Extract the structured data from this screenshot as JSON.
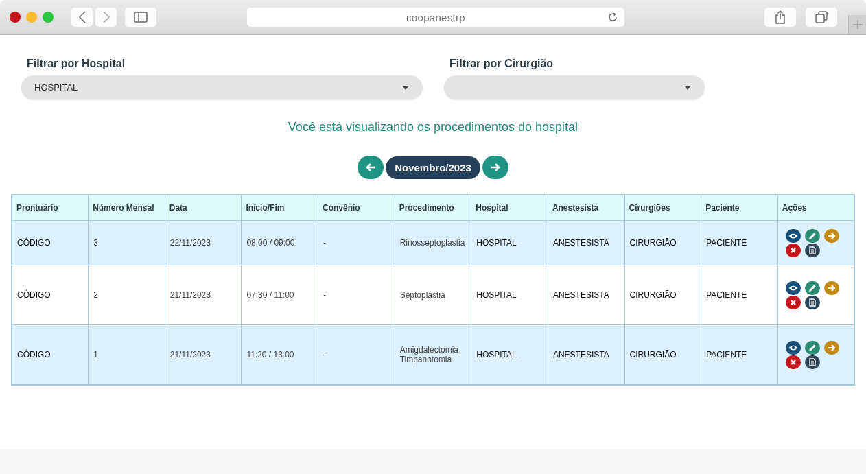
{
  "browser": {
    "url": "coopanestrp"
  },
  "filters": [
    {
      "label": "Filtrar por Hospital",
      "value": "HOSPITAL"
    },
    {
      "label": "Filtrar por Cirurgião"
    }
  ],
  "caption": "Você está visualizando os procedimentos do hospital",
  "month_nav": {
    "month": "Novembro/2023"
  },
  "table": {
    "columns": [
      "Prontuário",
      "Número Mensal",
      "Data",
      "Início/Fim",
      "Convênio",
      "Procedimento",
      "Hospital",
      "Anestesista",
      "Cirurgiões",
      "Paciente",
      "Ações"
    ],
    "rows": [
      {
        "cells": [
          "CÓDIGO",
          "3",
          "22/11/2023",
          "08:00 / 09:00",
          "-",
          "Rinosseptoplastia",
          "HOSPITAL",
          "ANESTESISTA",
          "CIRURGIÃO",
          "PACIENTE"
        ]
      },
      {
        "cells": [
          "CÓDIGO",
          "2",
          "21/11/2023",
          "07:30 / 11:00",
          "-",
          "Septoplastia",
          "HOSPITAL",
          "ANESTESISTA",
          "CIRURGIÃO",
          "PACIENTE"
        ]
      },
      {
        "cells": [
          "CÓDIGO",
          "1",
          "21/11/2023",
          "11:20 / 13:00",
          "-",
          "Amigdalectomia Timpanotomia",
          "HOSPITAL",
          "ANESTESISTA",
          "CIRURGIÃO",
          "PACIENTE"
        ]
      }
    ]
  }
}
